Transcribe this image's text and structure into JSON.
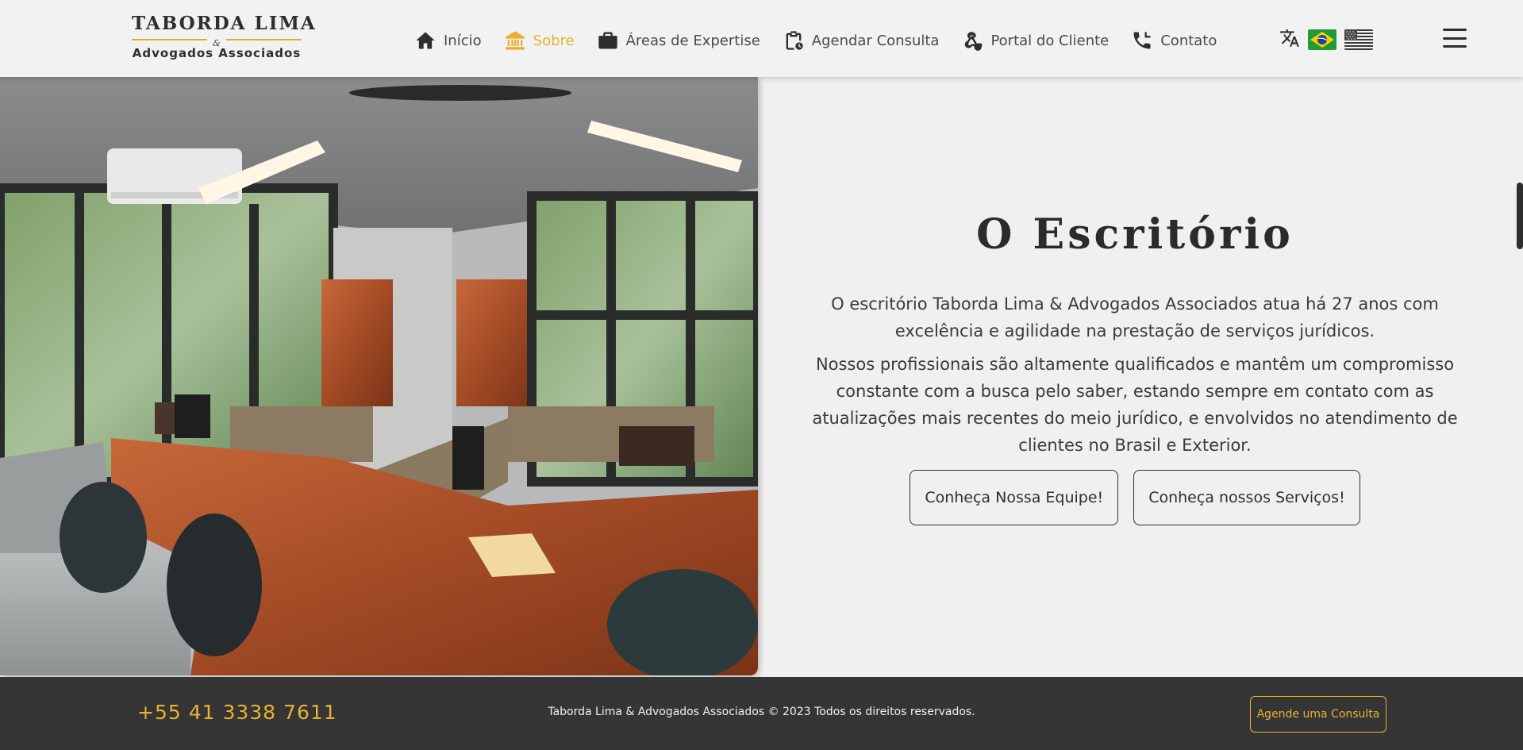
{
  "logo": {
    "main": "TABORDA LIMA",
    "amp": "&",
    "sub": "Advogados Associados"
  },
  "nav": [
    {
      "label": "Início",
      "icon": "home-icon",
      "active": false
    },
    {
      "label": "Sobre",
      "icon": "building-columns-icon",
      "active": true
    },
    {
      "label": "Áreas de Expertise",
      "icon": "briefcase-icon",
      "active": false
    },
    {
      "label": "Agendar Consulta",
      "icon": "clipboard-clock-icon",
      "active": false
    },
    {
      "label": "Portal do Cliente",
      "icon": "webhook-icon",
      "active": false
    },
    {
      "label": "Contato",
      "icon": "phone-icon",
      "active": false
    }
  ],
  "languages": {
    "icon": "translate-icon",
    "flags": [
      "brazil-flag",
      "usa-flag"
    ]
  },
  "section": {
    "title": "O Escritório",
    "paragraph1": "O escritório Taborda Lima & Advogados Associados atua há 27 anos com excelência e agilidade na prestação de serviços jurídicos.",
    "paragraph2": "Nossos profissionais são altamente qualificados e mantêm um compromisso constante com a busca pelo saber, estando sempre em contato com as atualizações mais recentes do meio jurídico, e envolvidos no atendimento de clientes no Brasil e Exterior.",
    "button_team": "Conheça Nossa Equipe!",
    "button_services": "Conheça nossos Serviços!"
  },
  "footer": {
    "phone": "+55 41 3338 7611",
    "copyright": "Taborda Lima & Advogados Associados © 2023 Todos os direitos reservados.",
    "cta": "Agende uma Consulta"
  },
  "colors": {
    "accent": "#e8b230",
    "dark": "#353535",
    "background": "#f0f0f0"
  }
}
